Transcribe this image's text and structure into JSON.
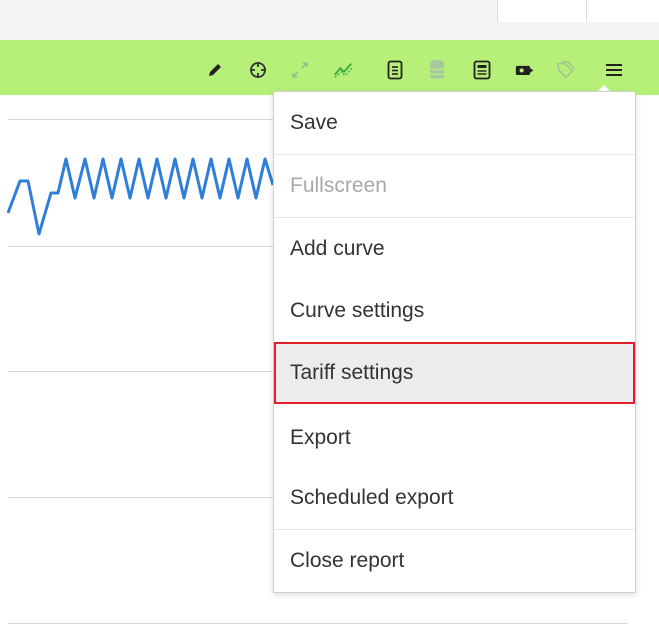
{
  "toolbar": {
    "color": "#b6f078",
    "icons": [
      {
        "name": "pencil-icon",
        "label": "Edit"
      },
      {
        "name": "crosshair-icon",
        "label": "Crosshair"
      },
      {
        "name": "expand-icon",
        "label": "Expand"
      },
      {
        "name": "trend-lines-icon",
        "label": "Trend lines"
      },
      {
        "name": "list-icon",
        "label": "List"
      },
      {
        "name": "database-icon",
        "label": "Database"
      },
      {
        "name": "document-icon",
        "label": "Document"
      },
      {
        "name": "tariff-tag-icon",
        "label": "Tariff"
      },
      {
        "name": "tags-icon",
        "label": "Tags"
      },
      {
        "name": "hamburger-menu-icon",
        "label": "Menu"
      }
    ]
  },
  "menu": {
    "items": [
      {
        "label": "Save",
        "enabled": true
      },
      {
        "label": "Fullscreen",
        "enabled": false
      },
      {
        "label": "Add curve",
        "enabled": true
      },
      {
        "label": "Curve settings",
        "enabled": true
      },
      {
        "label": "Tariff settings",
        "enabled": true,
        "highlighted": true
      },
      {
        "label": "Export",
        "enabled": true
      },
      {
        "label": "Scheduled export",
        "enabled": true
      },
      {
        "label": "Close report",
        "enabled": true
      }
    ]
  },
  "chart": {
    "line_color": "#2f7fd8"
  }
}
